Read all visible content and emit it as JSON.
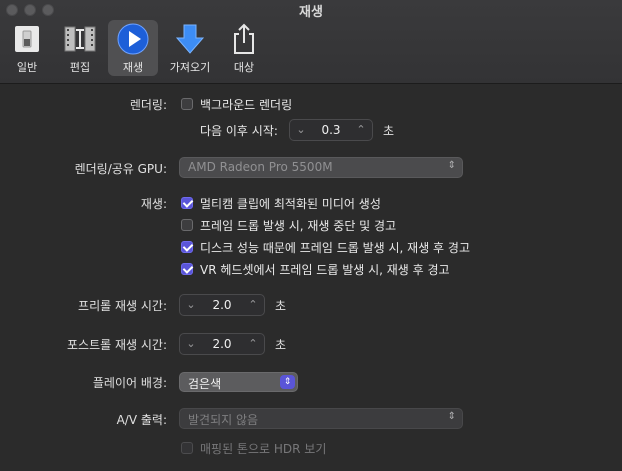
{
  "window": {
    "title": "재생"
  },
  "toolbar": {
    "items": [
      {
        "label": "일반",
        "icon": "switch-icon"
      },
      {
        "label": "편집",
        "icon": "film-edit-icon"
      },
      {
        "label": "재생",
        "icon": "play-icon"
      },
      {
        "label": "가져오기",
        "icon": "download-arrow-icon"
      },
      {
        "label": "대상",
        "icon": "share-icon"
      }
    ],
    "active": "재생"
  },
  "rendering": {
    "label": "렌더링:",
    "background_render": {
      "label": "백그라운드 렌더링",
      "checked": false
    },
    "start_after": {
      "label": "다음 이후 시작:",
      "value": "0.3",
      "unit": "초"
    }
  },
  "gpu": {
    "label": "렌더링/공유 GPU:",
    "value": "AMD Radeon Pro 5500M"
  },
  "playback": {
    "label": "재생:",
    "options": [
      {
        "label": "멀티캠 클립에 최적화된 미디어 생성",
        "checked": true
      },
      {
        "label": "프레임 드롭 발생 시, 재생 중단 및 경고",
        "checked": false
      },
      {
        "label": "디스크 성능 때문에 프레임 드롭 발생 시, 재생 후 경고",
        "checked": true
      },
      {
        "label": "VR 헤드셋에서 프레임 드롭 발생 시, 재생 후 경고",
        "checked": true
      }
    ]
  },
  "preroll": {
    "label": "프리롤 재생 시간:",
    "value": "2.0",
    "unit": "초"
  },
  "postroll": {
    "label": "포스트롤 재생 시간:",
    "value": "2.0",
    "unit": "초"
  },
  "player_background": {
    "label": "플레이어 배경:",
    "value": "검은색"
  },
  "av_output": {
    "label": "A/V 출력:",
    "value": "발견되지 않음"
  },
  "hdr": {
    "label": "매핑된 톤으로 HDR 보기",
    "checked": false,
    "enabled": false
  },
  "colors": {
    "accent": "#5a55d8",
    "background": "#2b2b2b"
  }
}
